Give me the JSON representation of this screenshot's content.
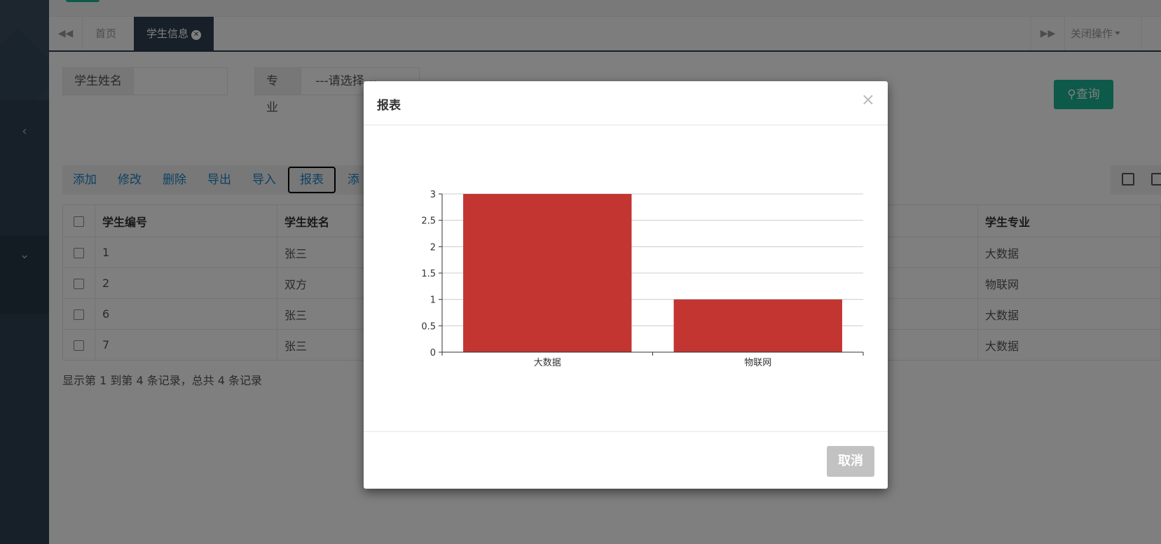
{
  "tabs": {
    "home": "首页",
    "student_info": "学生信息",
    "close_ops": "关闭操作"
  },
  "search": {
    "name_label": "学生姓名",
    "name_value": "",
    "major_label": "专业",
    "major_selected": "---请选择---",
    "query_button": "查询"
  },
  "toolbar": {
    "add": "添加",
    "edit": "修改",
    "delete": "删除",
    "export": "导出",
    "import": "导入",
    "report": "报表",
    "more": "添"
  },
  "table": {
    "headers": [
      "学生编号",
      "学生姓名",
      "学生专业"
    ],
    "rows": [
      {
        "id": "1",
        "name": "张三",
        "major": "大数据"
      },
      {
        "id": "2",
        "name": "双方",
        "major": "物联网"
      },
      {
        "id": "6",
        "name": "张三",
        "major": "大数据"
      },
      {
        "id": "7",
        "name": "张三",
        "major": "大数据"
      }
    ]
  },
  "pagination": {
    "info": "显示第 1 到第 4 条记录，总共 4 条记录"
  },
  "modal": {
    "title": "报表",
    "close": "×",
    "cancel_button": "取消"
  },
  "colors": {
    "bar": "#c23531",
    "sidebar": "#2f4050",
    "accent": "#1ab394"
  },
  "chart_data": {
    "type": "bar",
    "categories": [
      "大数据",
      "物联网"
    ],
    "values": [
      3,
      1
    ],
    "ylim": [
      0,
      3
    ],
    "yticks": [
      "0",
      "0.5",
      "1",
      "1.5",
      "2",
      "2.5",
      "3"
    ],
    "grid": true
  }
}
